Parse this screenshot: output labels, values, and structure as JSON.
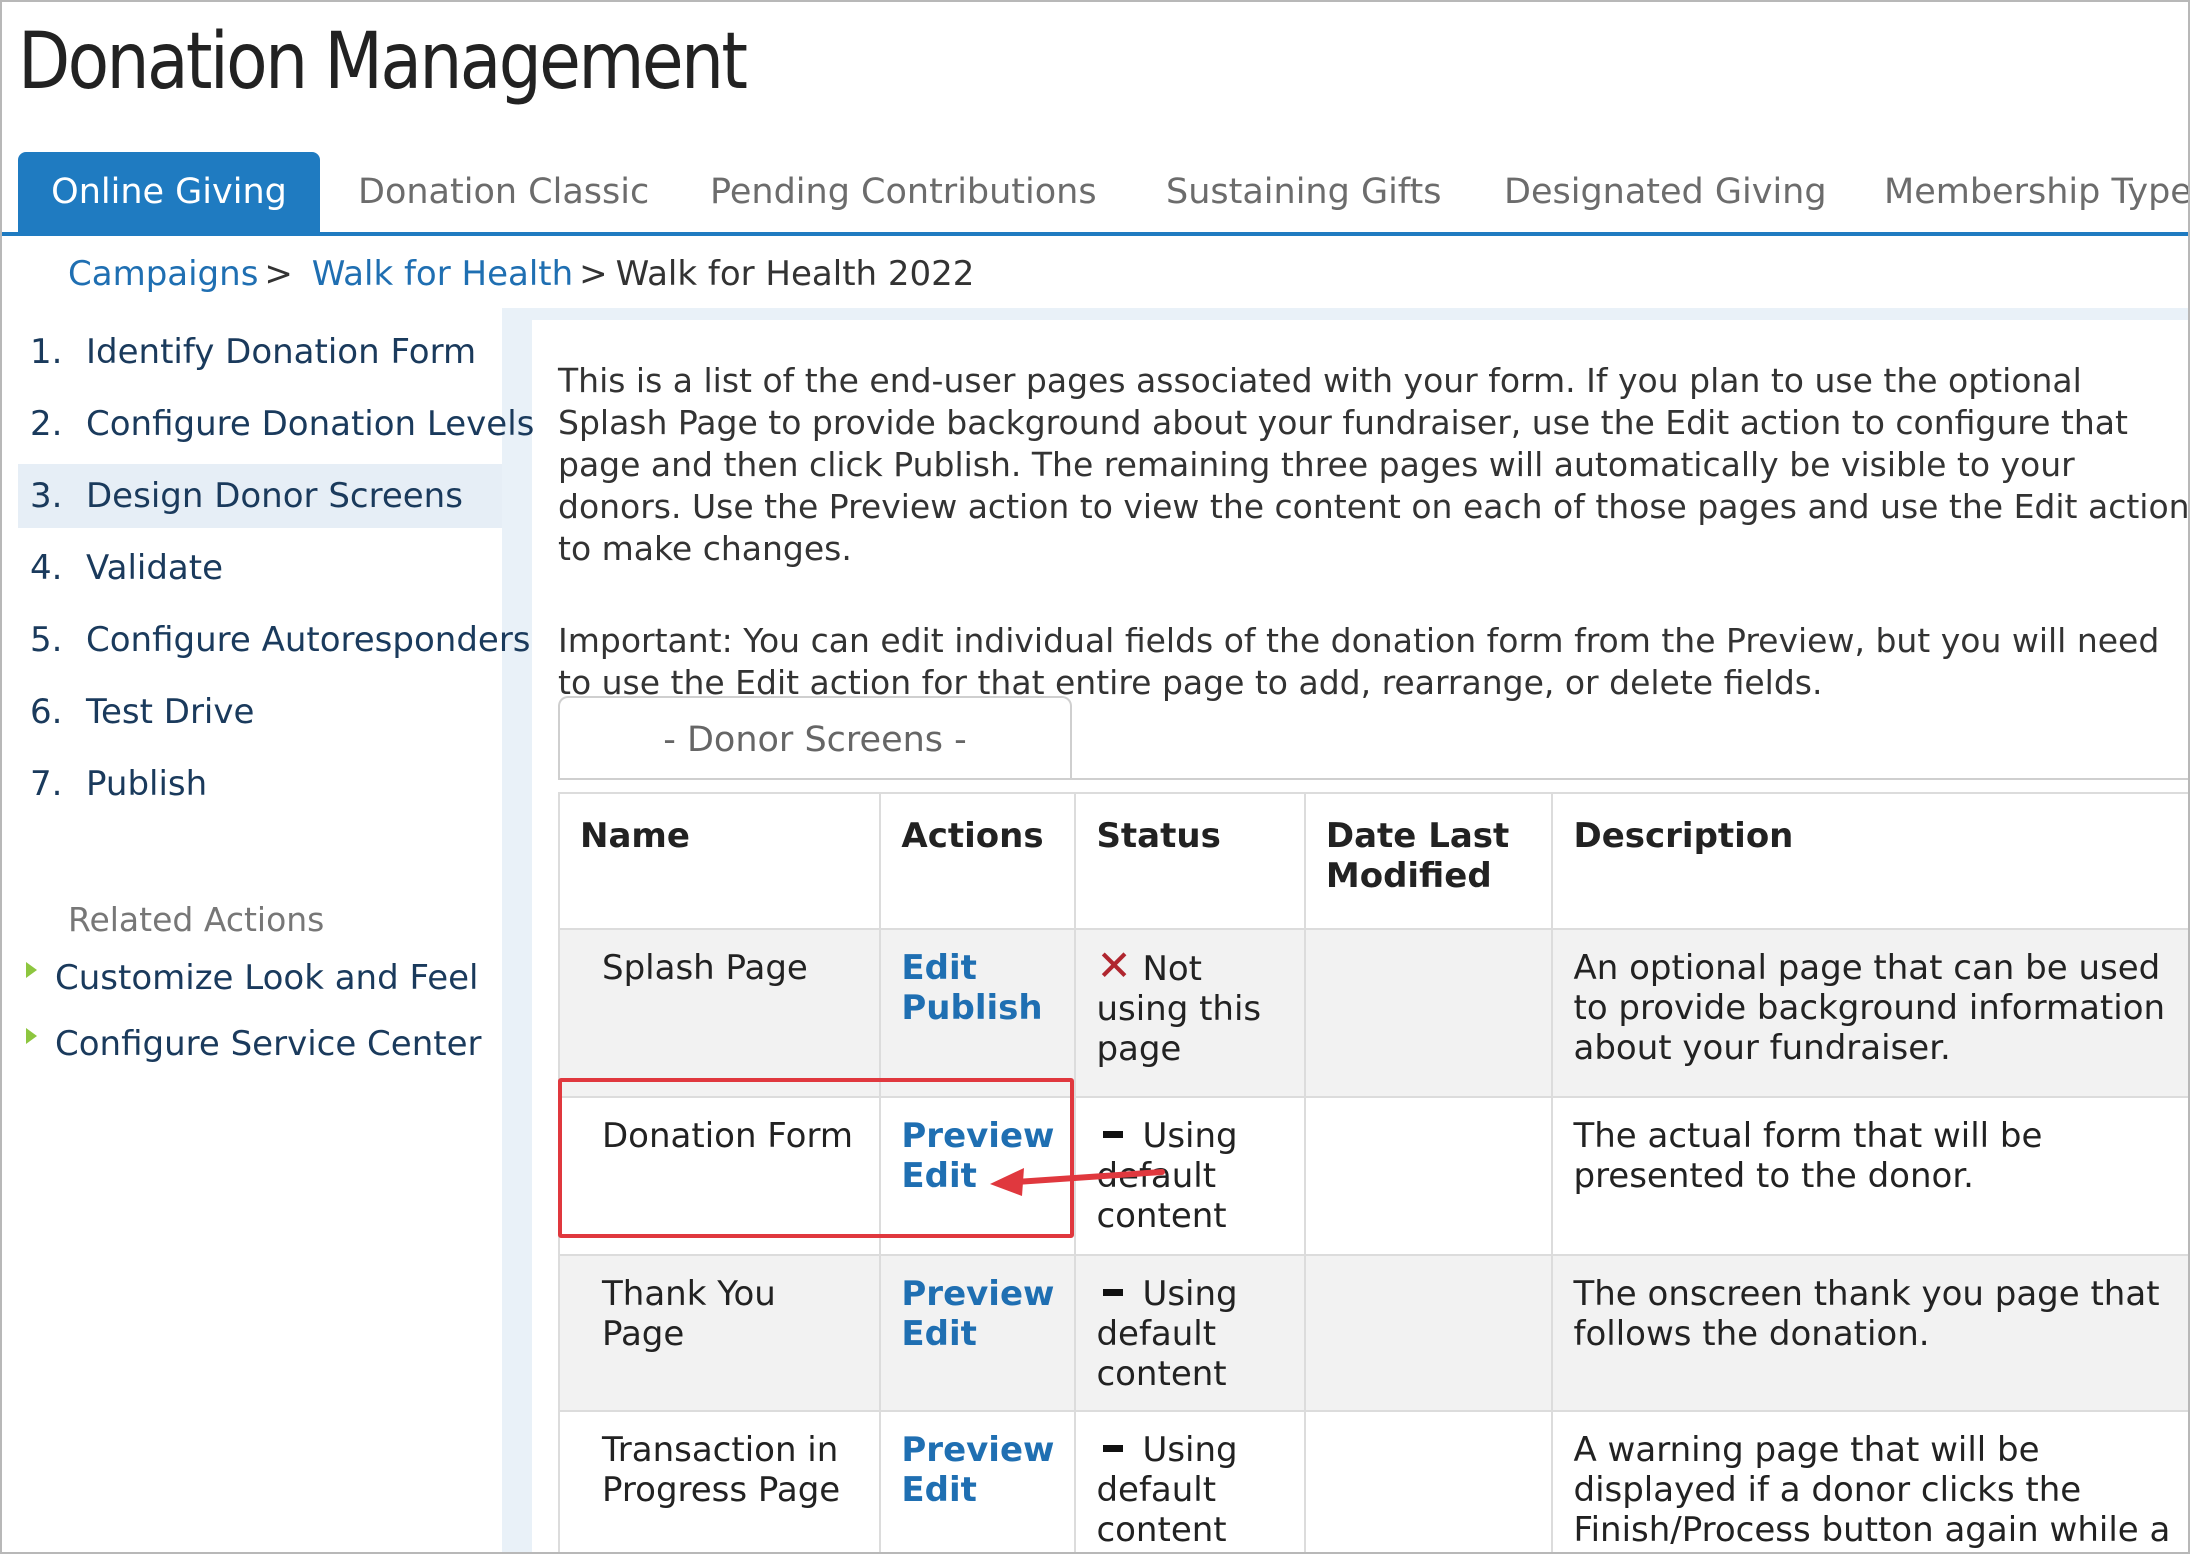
{
  "page": {
    "title": "Donation Management"
  },
  "tabs": [
    {
      "label": "Online Giving",
      "active": true
    },
    {
      "label": "Donation Classic",
      "active": false
    },
    {
      "label": "Pending Contributions",
      "active": false
    },
    {
      "label": "Sustaining Gifts",
      "active": false
    },
    {
      "label": "Designated Giving",
      "active": false
    },
    {
      "label": "Membership Types",
      "active": false
    }
  ],
  "breadcrumb": {
    "items": [
      "Campaigns",
      "Walk for Health"
    ],
    "current": "Walk for Health 2022",
    "separator": ">"
  },
  "steps": [
    {
      "num": "1.",
      "label": "Identify Donation Form"
    },
    {
      "num": "2.",
      "label": "Configure Donation Levels"
    },
    {
      "num": "3.",
      "label": "Design Donor Screens",
      "active": true
    },
    {
      "num": "4.",
      "label": "Validate"
    },
    {
      "num": "5.",
      "label": "Configure Autoresponders"
    },
    {
      "num": "6.",
      "label": "Test Drive"
    },
    {
      "num": "7.",
      "label": "Publish"
    }
  ],
  "related": {
    "title": "Related Actions",
    "items": [
      "Customize Look and Feel",
      "Configure Service Center"
    ]
  },
  "intro": {
    "p1": "This is a list of the end-user pages associated with your form. If you plan to use the optional Splash Page to provide background about your fundraiser, use the Edit action to configure that page and then click Publish. The remaining three pages will automatically be visible to your donors. Use the Preview action to view the content on each of those pages and use the Edit action to make changes.",
    "p2": "Important: You can edit individual fields of the donation form from the Preview, but you will need to use the Edit action for that entire page to add, rearrange, or delete fields."
  },
  "section_tab": "- Donor Screens -",
  "table": {
    "headers": [
      "Name",
      "Actions",
      "Status",
      "Date Last Modified",
      "Description"
    ],
    "rows": [
      {
        "name": "Splash Page",
        "actions": [
          "Edit",
          "Publish"
        ],
        "status_icon": "x-mark-icon",
        "status": "Not using this page",
        "date": "",
        "description": "An optional page that can be used to provide background information about your fundraiser."
      },
      {
        "name": "Donation Form",
        "actions": [
          "Preview",
          "Edit"
        ],
        "status_icon": "dash-icon",
        "status": "Using default content",
        "date": "",
        "description": "The actual form that will be presented to the donor."
      },
      {
        "name": "Thank You Page",
        "actions": [
          "Preview",
          "Edit"
        ],
        "status_icon": "dash-icon",
        "status": "Using default content",
        "date": "",
        "description": "The onscreen thank you page that follows the donation."
      },
      {
        "name": "Transaction in Progress Page",
        "actions": [
          "Preview",
          "Edit"
        ],
        "status_icon": "dash-icon",
        "status": "Using default content",
        "date": "",
        "description": "A warning page that will be displayed if a donor clicks the Finish/Process button again while a transaction is still"
      }
    ]
  },
  "colors": {
    "accent": "#1f7bc1",
    "link": "#1f6fb2",
    "highlight": "#e0383e",
    "bullet": "#8dc63f",
    "x_mark": "#b0262f"
  }
}
